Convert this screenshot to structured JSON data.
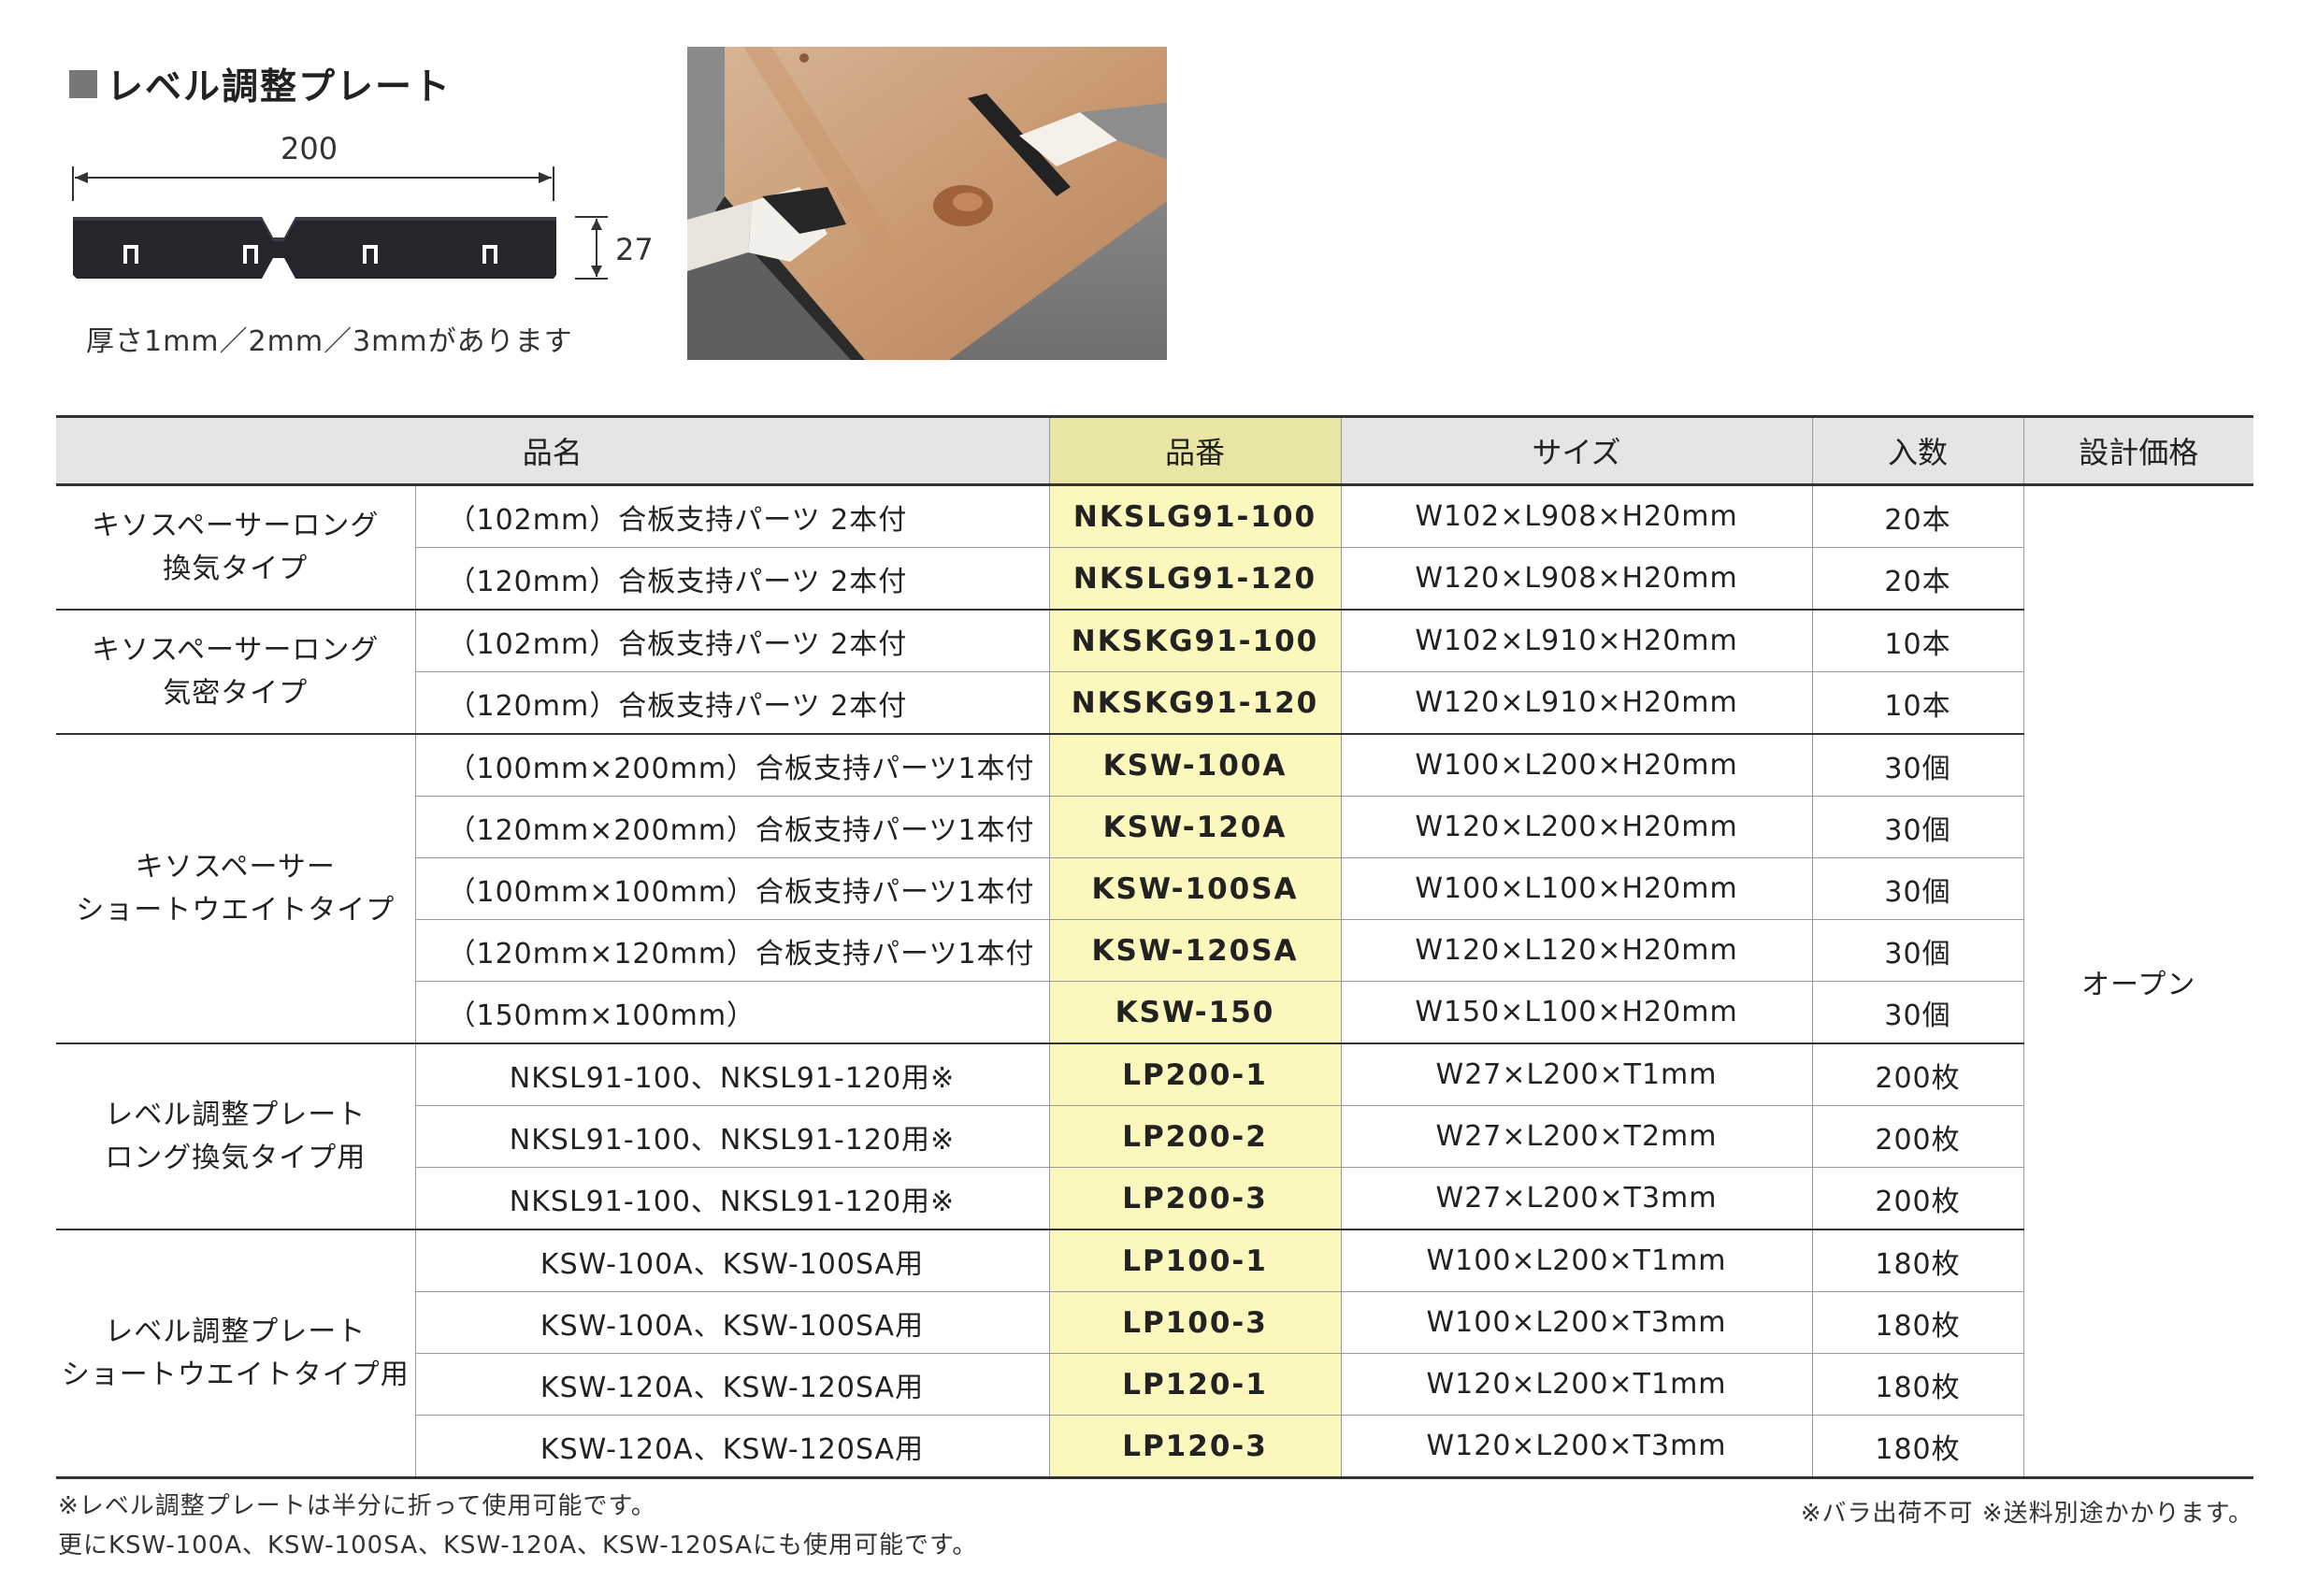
{
  "heading": "レベル調整プレート",
  "diagram": {
    "width_label": "200",
    "height_label": "27"
  },
  "thickness_note": "厚さ1mm／2mm／3mmがあります",
  "table": {
    "headers": [
      "品名",
      "品番",
      "サイズ",
      "入数",
      "設計価格"
    ],
    "price": "オープン",
    "groups": [
      {
        "category": [
          "キソスペーサーロング",
          "換気タイプ"
        ],
        "rows": [
          {
            "desc": "（102mm）合板支持パーツ 2本付",
            "code": "NKSLG91-100",
            "size": "W102×L908×H20mm",
            "qty": "20本"
          },
          {
            "desc": "（120mm）合板支持パーツ 2本付",
            "code": "NKSLG91-120",
            "size": "W120×L908×H20mm",
            "qty": "20本"
          }
        ]
      },
      {
        "category": [
          "キソスペーサーロング",
          "気密タイプ"
        ],
        "rows": [
          {
            "desc": "（102mm）合板支持パーツ 2本付",
            "code": "NKSKG91-100",
            "size": "W102×L910×H20mm",
            "qty": "10本"
          },
          {
            "desc": "（120mm）合板支持パーツ 2本付",
            "code": "NKSKG91-120",
            "size": "W120×L910×H20mm",
            "qty": "10本"
          }
        ]
      },
      {
        "category": [
          "キソスペーサー",
          "ショートウエイトタイプ"
        ],
        "rows": [
          {
            "desc": "（100mm×200mm）合板支持パーツ1本付",
            "code": "KSW-100A",
            "size": "W100×L200×H20mm",
            "qty": "30個"
          },
          {
            "desc": "（120mm×200mm）合板支持パーツ1本付",
            "code": "KSW-120A",
            "size": "W120×L200×H20mm",
            "qty": "30個"
          },
          {
            "desc": "（100mm×100mm）合板支持パーツ1本付",
            "code": "KSW-100SA",
            "size": "W100×L100×H20mm",
            "qty": "30個"
          },
          {
            "desc": "（120mm×120mm）合板支持パーツ1本付",
            "code": "KSW-120SA",
            "size": "W120×L120×H20mm",
            "qty": "30個"
          },
          {
            "desc": "（150mm×100mm）",
            "code": "KSW-150",
            "size": "W150×L100×H20mm",
            "qty": "30個"
          }
        ]
      },
      {
        "category": [
          "レベル調整プレート",
          "ロング換気タイプ用"
        ],
        "rows": [
          {
            "desc": "NKSL91-100、NKSL91-120用※",
            "code": "LP200-1",
            "size": "W27×L200×T1mm",
            "qty": "200枚"
          },
          {
            "desc": "NKSL91-100、NKSL91-120用※",
            "code": "LP200-2",
            "size": "W27×L200×T2mm",
            "qty": "200枚"
          },
          {
            "desc": "NKSL91-100、NKSL91-120用※",
            "code": "LP200-3",
            "size": "W27×L200×T3mm",
            "qty": "200枚"
          }
        ]
      },
      {
        "category": [
          "レベル調整プレート",
          "ショートウエイトタイプ用"
        ],
        "rows": [
          {
            "desc": "KSW-100A、KSW-100SA用",
            "code": "LP100-1",
            "size": "W100×L200×T1mm",
            "qty": "180枚"
          },
          {
            "desc": "KSW-100A、KSW-100SA用",
            "code": "LP100-3",
            "size": "W100×L200×T3mm",
            "qty": "180枚"
          },
          {
            "desc": "KSW-120A、KSW-120SA用",
            "code": "LP120-1",
            "size": "W120×L200×T1mm",
            "qty": "180枚"
          },
          {
            "desc": "KSW-120A、KSW-120SA用",
            "code": "LP120-3",
            "size": "W120×L200×T3mm",
            "qty": "180枚"
          }
        ]
      }
    ]
  },
  "notes": {
    "line1": "※レベル調整プレートは半分に折って使用可能です。",
    "line2": "更にKSW-100A、KSW-100SA、KSW-120A、KSW-120SAにも使用可能です。",
    "right": "※バラ出荷不可 ※送料別途かかります。"
  }
}
